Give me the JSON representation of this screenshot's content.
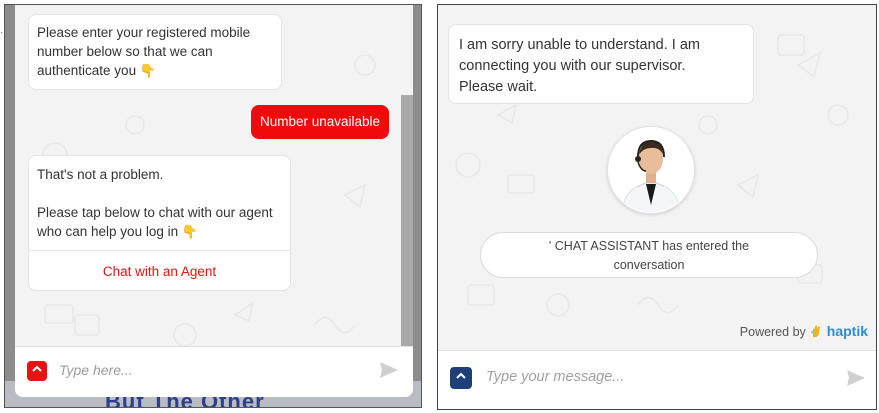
{
  "left": {
    "bot_message_1": [
      "Please enter your registered mobile",
      "number below so that we can",
      "authenticate you"
    ],
    "user_reply": "Number unavailable",
    "bot_message_2": {
      "line1": "That's not a problem.",
      "line2": "Please tap below to chat with our agent",
      "line3": "who can help you log in",
      "action": "Chat with an Agent"
    },
    "input_placeholder": "Type here...",
    "background_text": "But The Other"
  },
  "right": {
    "bot_message": [
      "I am sorry unable to understand. I am",
      "connecting you with our supervisor.",
      "Please wait."
    ],
    "system_message": [
      "' CHAT ASSISTANT has entered the",
      "conversation"
    ],
    "powered_by": "Powered by",
    "brand": "haptik",
    "input_placeholder": "Type your message..."
  },
  "colors": {
    "accent_red": "#f00a0a",
    "accent_navy": "#1f3f7a",
    "brand_blue": "#2b8dd6"
  },
  "icons": {
    "toggle": "chevron-up-icon",
    "send": "send-icon",
    "emoji": "pointing-down-hand-icon"
  }
}
